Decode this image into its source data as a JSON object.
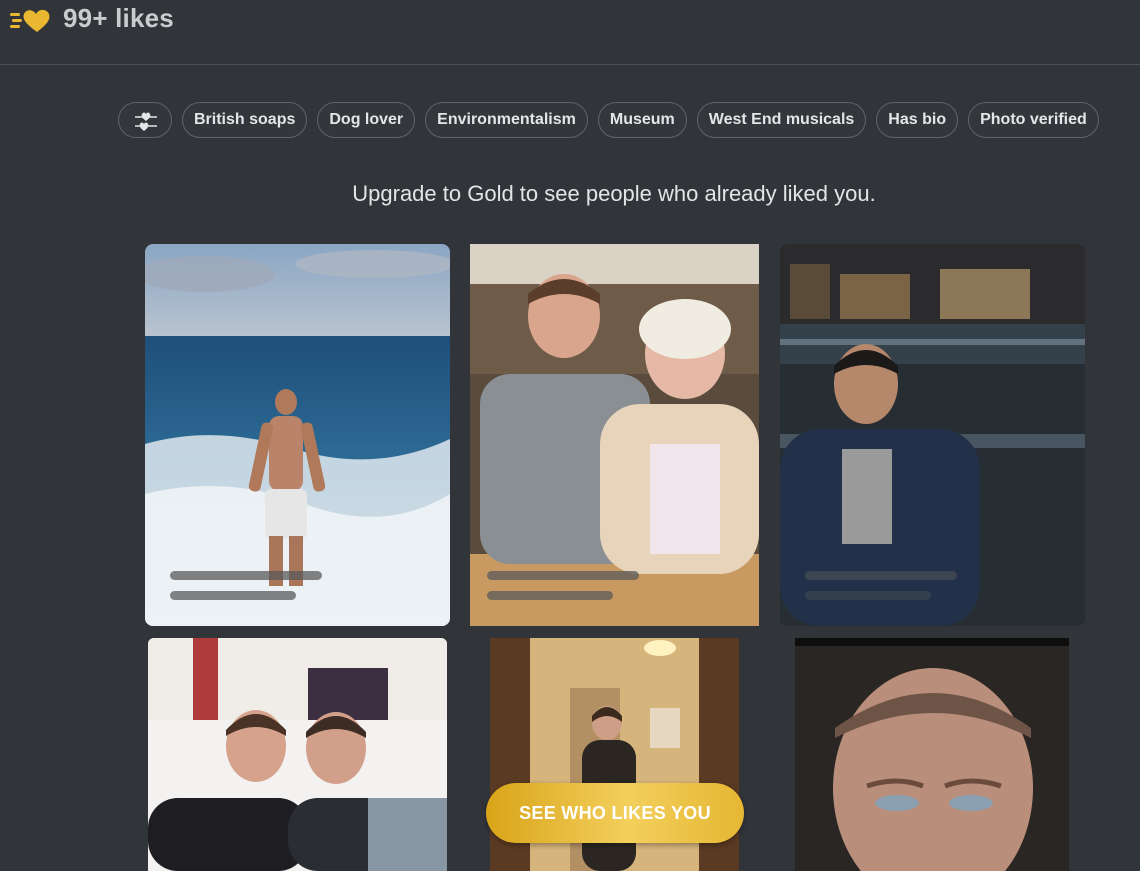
{
  "header": {
    "likes_count_label": "99+ likes",
    "logo_icon": "gold-heart-speed-icon"
  },
  "filters": {
    "filter_icon": "heart-slider-icon",
    "chips": [
      "British soaps",
      "Dog lover",
      "Environmentalism",
      "Museum",
      "West End musicals",
      "Has bio",
      "Photo verified"
    ]
  },
  "upgrade_message": "Upgrade to Gold to see people who already liked you.",
  "cta": {
    "label": "SEE WHO LIKES YOU"
  },
  "colors": {
    "background": "#31353a",
    "gold": "#e9b730",
    "chip_border": "#5e636a"
  }
}
